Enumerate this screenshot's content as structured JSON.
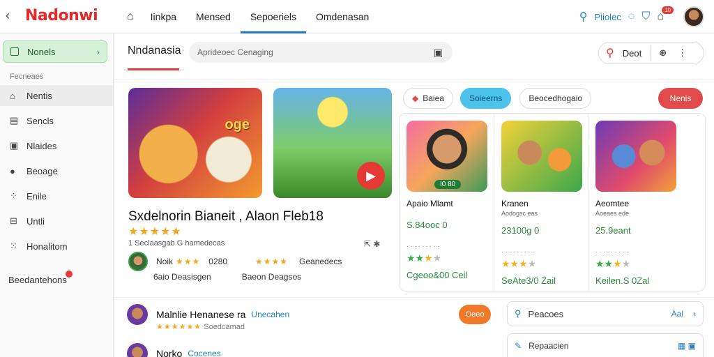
{
  "topbar": {
    "back": "‹",
    "logo": "Nadonwi",
    "tabs": [
      "Iinkpa",
      "Mensed",
      "Sepoeriels",
      "Omdenasan"
    ],
    "help_link": "Piiolec",
    "notif_badge": "10"
  },
  "sidebar": {
    "top_item": "Nonels",
    "section": "Fecneaes",
    "items": [
      "Nentis",
      "Sencls",
      "Nlaides",
      "Beoage",
      "Enile",
      "Untli",
      "Honalitom"
    ],
    "footer": "Beedantehons"
  },
  "header": {
    "section_title": "Nndanasia",
    "search_placeholder": "Aprideoec Cenaging",
    "filter_label": "Deot"
  },
  "featured": {
    "hero1_tag": "oge",
    "title": "Sxdelnorin Bianeit , Alaon Fleb18",
    "rating_stars": "★★★★★",
    "meta": "1 Seclaasgab G hamedecas",
    "review1": {
      "name": "Noik",
      "stars": "★★★",
      "text": "0280",
      "stars2": "★★★★",
      "text2": "Geanedecs"
    },
    "review2": {
      "a": "6aio",
      "b": "Deasisgen",
      "c": "Baeon",
      "d": "Deagsos"
    }
  },
  "pills": {
    "p1": "Baiea",
    "p2": "Soieerns",
    "p3": "Beocedhogaio",
    "red": "Nenis"
  },
  "cards": [
    {
      "name": "Apaio Mlamt",
      "sub": "",
      "price": "S.84ooc 0",
      "chip": "I0 80",
      "rating_g": "★★",
      "rating_y": "★",
      "rating_e": "★",
      "cta": "Cgeoo&00 Ceil"
    },
    {
      "name": "Kranen",
      "sub": "Aodogsc eas",
      "price": "23100g 0",
      "rating_g": "",
      "rating_y": "★★★",
      "rating_e": "★",
      "cta": "SeAte3/0 Zail"
    },
    {
      "name": "Aeomtee",
      "sub": "Aoeaes ede",
      "price": "25.9eant",
      "rating_g": "★★",
      "rating_y": "★",
      "rating_e": "★",
      "cta": "Keilen.S 0Zal"
    }
  ],
  "list": {
    "row1": {
      "name": "Malnlie Henanese ra",
      "link": "Unecahen",
      "stars": "★★★★★★",
      "sub": "Soedcamad"
    },
    "row2": {
      "name": "Norko",
      "link": "Cocenes"
    },
    "button": "Oeeo"
  },
  "right": {
    "box1": "Peacoes",
    "box1_end": "Aal",
    "box2": "Repaacien"
  }
}
